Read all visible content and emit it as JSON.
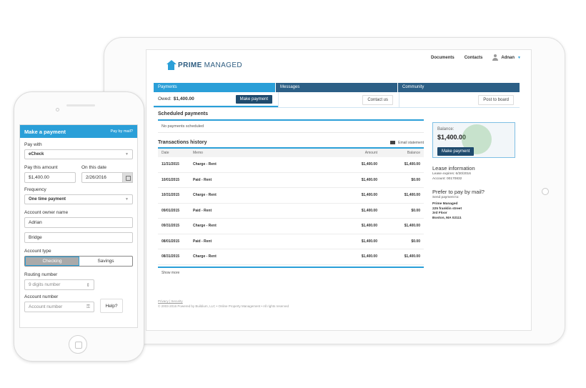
{
  "tablet": {
    "nav": {
      "documents": "Documents",
      "contacts": "Contacts",
      "user": "Adnan"
    },
    "logo": {
      "bold": "PRIME",
      "light": "MANAGED"
    },
    "tabs": [
      {
        "label": "Payments"
      },
      {
        "label": "Messages"
      },
      {
        "label": "Community"
      }
    ],
    "owed_label": "Owed:",
    "owed_value": "$1,400.00",
    "make_payment": "Make payment",
    "contact_us": "Contact us",
    "post_to_board": "Post to board",
    "scheduled_title": "Scheduled payments",
    "no_payments": "No payments scheduled",
    "history_title": "Transactions history",
    "email_statement": "Email statement",
    "table_headers": {
      "date": "Date",
      "memo": "Memo",
      "amount": "Amount",
      "balance": "Balance"
    },
    "transactions": [
      {
        "date": "11/31/2015",
        "memo": "Charge - Rent",
        "amount": "$1,400.00",
        "balance": "$1,400.00"
      },
      {
        "date": "10/01/2015",
        "memo": "Paid - Rent",
        "amount": "$1,400.00",
        "balance": "$0.00"
      },
      {
        "date": "10/31/2015",
        "memo": "Charge - Rent",
        "amount": "$1,400.00",
        "balance": "$1,400.00"
      },
      {
        "date": "09/01/2015",
        "memo": "Paid - Rent",
        "amount": "$1,400.00",
        "balance": "$0.00"
      },
      {
        "date": "09/31/2015",
        "memo": "Charge - Rent",
        "amount": "$1,400.00",
        "balance": "$1,400.00"
      },
      {
        "date": "08/01/2015",
        "memo": "Paid - Rent",
        "amount": "$1,400.00",
        "balance": "$0.00"
      },
      {
        "date": "08/31/2015",
        "memo": "Charge - Rent",
        "amount": "$1,400.00",
        "balance": "$1,400.00"
      }
    ],
    "show_more": "Show more",
    "balance_label": "Balance:",
    "balance_value": "$1,400.00",
    "lease_title": "Lease information",
    "lease_expires": "Lease expires: 6/30/2016",
    "account": "Account: 00170832",
    "mail_title": "Prefer to pay by mail?",
    "send_payment_to": "Send payment to:",
    "address": [
      "Prime Managed",
      "225 franklin street",
      "3rd Floor",
      "Boston, MA 02111"
    ],
    "footer_links": "Privacy | Security",
    "footer_copy": "© 2003-2016 Powered by Buildium, LLC • Online Property Management • All rights reserved"
  },
  "phone": {
    "title": "Make a payment",
    "pay_by_mail": "Pay by mail?",
    "pay_with_label": "Pay with",
    "pay_with_value": "eCheck",
    "pay_amount_label": "Pay this amount",
    "pay_amount_value": "$1,400.00",
    "date_label": "On this date",
    "date_value": "2/26/2016",
    "frequency_label": "Frequency",
    "frequency_value": "One time payment",
    "owner_label": "Account owner name",
    "first_name": "Adrian",
    "last_name": "Bridge",
    "type_label": "Account type",
    "checking": "Checking",
    "savings": "Savings",
    "routing_label": "Routing number",
    "routing_placeholder": "9 digits number",
    "account_label": "Account number",
    "account_placeholder": "Account number",
    "help": "Help?"
  },
  "colors": {
    "accent": "#2a9fd8",
    "nav_dark": "#2c5f86",
    "button_dark": "#1f4b6e"
  }
}
